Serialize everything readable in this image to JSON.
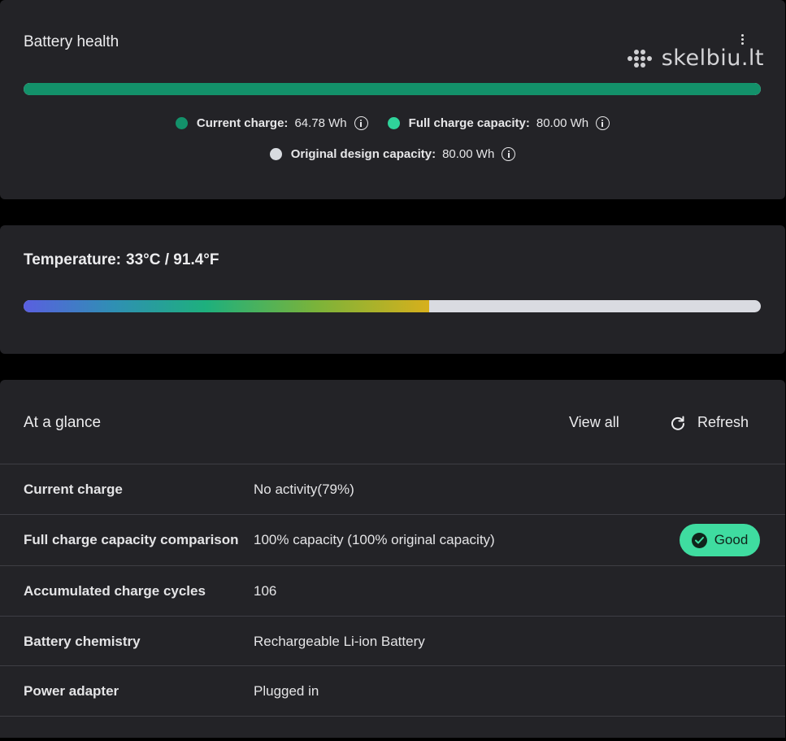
{
  "battery": {
    "title": "Battery health",
    "health_fill_fraction": 1.0,
    "legend": {
      "current_charge_label": "Current charge:",
      "current_charge_value": "64.78 Wh",
      "full_capacity_label": "Full charge capacity:",
      "full_capacity_value": "80.00 Wh",
      "design_capacity_label": "Original design capacity:",
      "design_capacity_value": "80.00 Wh"
    },
    "colors": {
      "current": "#13916a",
      "full": "#2fd39a",
      "design": "#d8dbe0"
    }
  },
  "watermark": {
    "text": "skelbiu.lt"
  },
  "temperature": {
    "label": "Temperature:",
    "value": "33°C / 91.4°F",
    "bar_fill_fraction": 0.55
  },
  "glance": {
    "title": "At a glance",
    "view_all_label": "View all",
    "refresh_label": "Refresh",
    "rows": [
      {
        "label": "Current charge",
        "value": "No activity(79%)"
      },
      {
        "label": "Full charge capacity comparison",
        "value": "100% capacity (100% original capacity)",
        "badge": "Good"
      },
      {
        "label": "Accumulated charge cycles",
        "value": "106"
      },
      {
        "label": "Battery chemistry",
        "value": "Rechargeable Li-ion Battery"
      },
      {
        "label": "Power adapter",
        "value": "Plugged in"
      }
    ]
  }
}
